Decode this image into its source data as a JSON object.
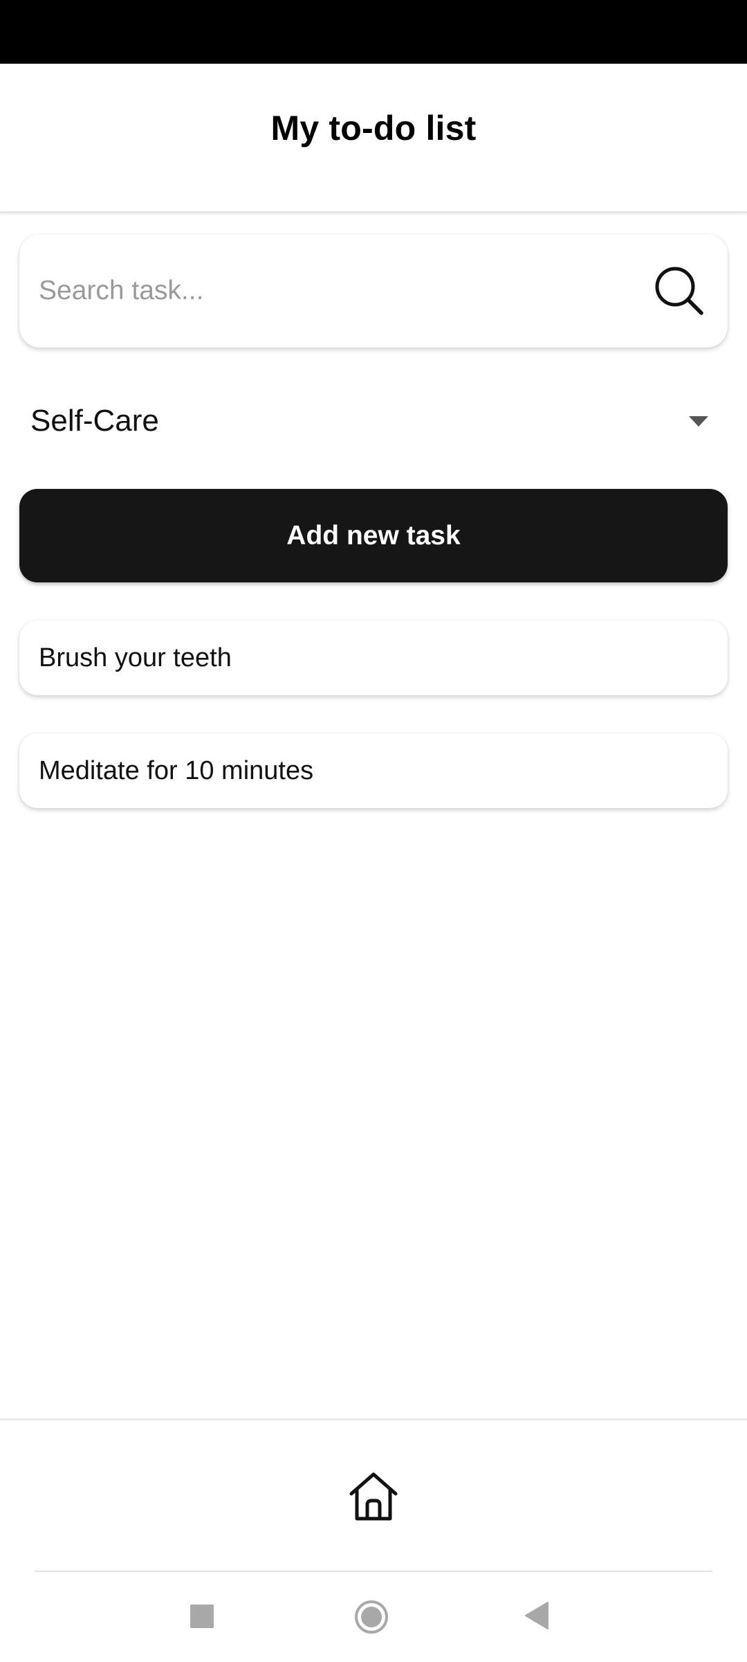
{
  "header": {
    "title": "My to-do list"
  },
  "search": {
    "placeholder": "Search task...",
    "icon": "search-icon"
  },
  "category": {
    "selected": "Self-Care",
    "icon": "chevron-down-icon"
  },
  "actions": {
    "add_label": "Add new task"
  },
  "tasks": [
    {
      "label": "Brush your teeth"
    },
    {
      "label": "Meditate for 10 minutes"
    }
  ],
  "bottom_nav": {
    "items": [
      {
        "icon": "home-icon"
      }
    ]
  },
  "system_nav": {
    "items": [
      "recents-icon",
      "home-circle-icon",
      "back-icon"
    ]
  },
  "colors": {
    "status_bar": "#000000",
    "button": "#161616",
    "button_text": "#ffffff",
    "placeholder": "#9a9a9a"
  }
}
